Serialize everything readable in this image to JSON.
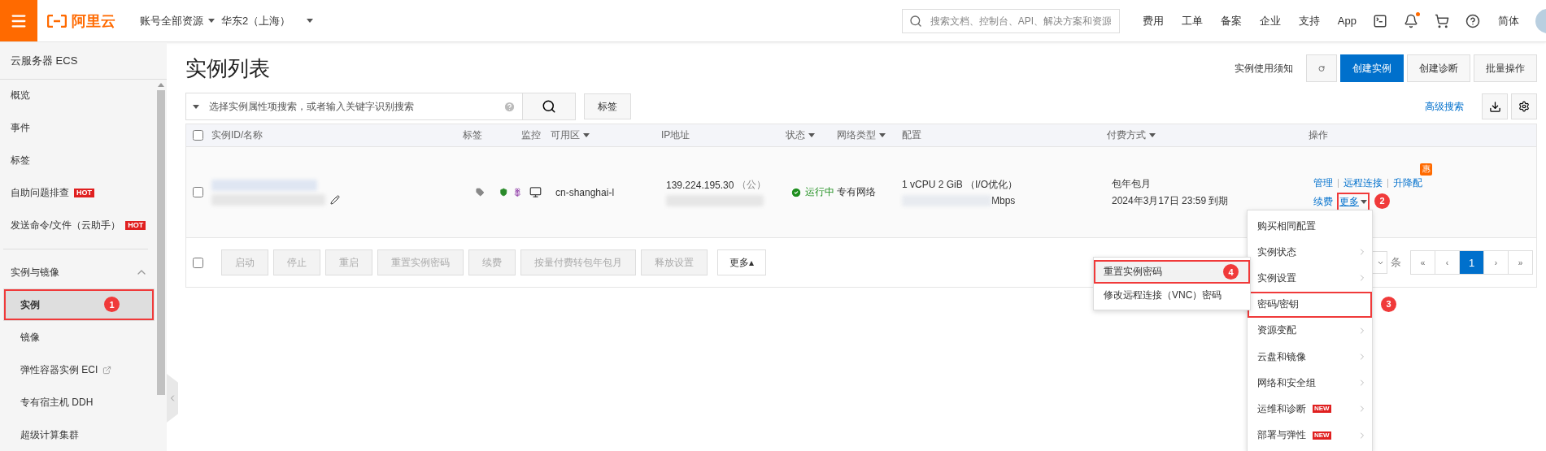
{
  "topbar": {
    "logo_text": "阿里云",
    "account": "账号全部资源",
    "region": "华东2（上海）",
    "search_placeholder": "搜索文档、控制台、API、解决方案和资源",
    "nav": [
      "费用",
      "工单",
      "备案",
      "企业",
      "支持",
      "App"
    ],
    "bell_dot": true,
    "language": "简体"
  },
  "sidebar": {
    "title": "云服务器 ECS",
    "items": [
      {
        "label": "概览"
      },
      {
        "label": "事件"
      },
      {
        "label": "标签"
      },
      {
        "label": "自助问题排查",
        "tag": "HOT"
      },
      {
        "label": "发送命令/文件（云助手）",
        "tag": "HOT"
      }
    ],
    "group": {
      "label": "实例与镜像",
      "expanded": true,
      "items": [
        {
          "label": "实例",
          "selected": true,
          "external": false,
          "step": "1"
        },
        {
          "label": "镜像",
          "selected": false,
          "external": false
        },
        {
          "label": "弹性容器实例 ECI",
          "selected": false,
          "external": true
        },
        {
          "label": "专有宿主机 DDH",
          "selected": false,
          "external": false
        },
        {
          "label": "超级计算集群",
          "selected": false,
          "external": false
        }
      ]
    }
  },
  "page": {
    "title": "实例列表",
    "notice": "实例使用须知",
    "buttons": [
      {
        "label": "创建实例",
        "primary": true
      },
      {
        "label": "创建诊断",
        "primary": false
      },
      {
        "label": "批量操作",
        "primary": false
      }
    ],
    "search_placeholder": "选择实例属性项搜索，或者输入关键字识别搜索",
    "tag_button": "标签",
    "advanced_search": "高级搜索"
  },
  "table": {
    "select_all_checked": false,
    "columns": [
      {
        "label": "实例ID/名称",
        "sortable": false
      },
      {
        "label": "标签",
        "sortable": false
      },
      {
        "label": "监控",
        "sortable": false
      },
      {
        "label": "可用区",
        "sortable": true
      },
      {
        "label": "IP地址",
        "sortable": false
      },
      {
        "label": "状态",
        "sortable": true
      },
      {
        "label": "网络类型",
        "sortable": true
      },
      {
        "label": "配置",
        "sortable": false
      },
      {
        "label": "付费方式",
        "sortable": true
      },
      {
        "label": "操作",
        "sortable": false
      }
    ],
    "rows": [
      {
        "checked": false,
        "redacted": true,
        "zone": "cn-shanghai-l",
        "ip": "139.224.195.30",
        "ip_note": "（公）",
        "status": "运行中",
        "network": "专有网络",
        "config": "1 vCPU 2 GiB （I/O优化）",
        "bandwidth": "Mbps",
        "billing": "包年包月",
        "expiry": "2024年3月17日 23:59 到期",
        "actions": [
          [
            {
              "label": "管理"
            },
            {
              "label": "远程连接"
            },
            {
              "label": "升降配",
              "badge": "惠"
            }
          ],
          [
            {
              "label": "续费"
            },
            {
              "label": "更多",
              "caret": true,
              "step": "2"
            }
          ]
        ]
      }
    ],
    "footer": {
      "checked": false,
      "buttons": [
        {
          "label": "启动",
          "disabled": true
        },
        {
          "label": "停止",
          "disabled": true
        },
        {
          "label": "重启",
          "disabled": true
        },
        {
          "label": "重置实例密码",
          "disabled": true
        },
        {
          "label": "续费",
          "disabled": true
        },
        {
          "label": "按量付费转包年包月",
          "disabled": true
        },
        {
          "label": "释放设置",
          "disabled": true
        },
        {
          "label": "更多▴",
          "disabled": false
        }
      ],
      "page_size_unit": "条",
      "pagination": [
        {
          "label": "«",
          "selected": false
        },
        {
          "label": "‹",
          "selected": false
        },
        {
          "label": "1",
          "selected": true
        },
        {
          "label": "›",
          "selected": false
        },
        {
          "label": "»",
          "selected": false
        }
      ]
    }
  },
  "menu": {
    "items": [
      {
        "label": "购买相同配置",
        "submenu": false
      },
      {
        "label": "实例状态",
        "submenu": true
      },
      {
        "label": "实例设置",
        "submenu": true
      },
      {
        "label": "密码/密钥",
        "submenu": false,
        "step": "3"
      },
      {
        "label": "资源变配",
        "submenu": true
      },
      {
        "label": "云盘和镜像",
        "submenu": true
      },
      {
        "label": "网络和安全组",
        "submenu": true
      },
      {
        "label": "运维和诊断",
        "submenu": true,
        "badge": "NEW"
      },
      {
        "label": "部署与弹性",
        "submenu": true,
        "badge": "NEW"
      }
    ],
    "submenu": [
      {
        "label": "重置实例密码",
        "highlighted": true,
        "step": "4"
      },
      {
        "label": "修改远程连接（VNC）密码",
        "highlighted": false
      }
    ]
  }
}
